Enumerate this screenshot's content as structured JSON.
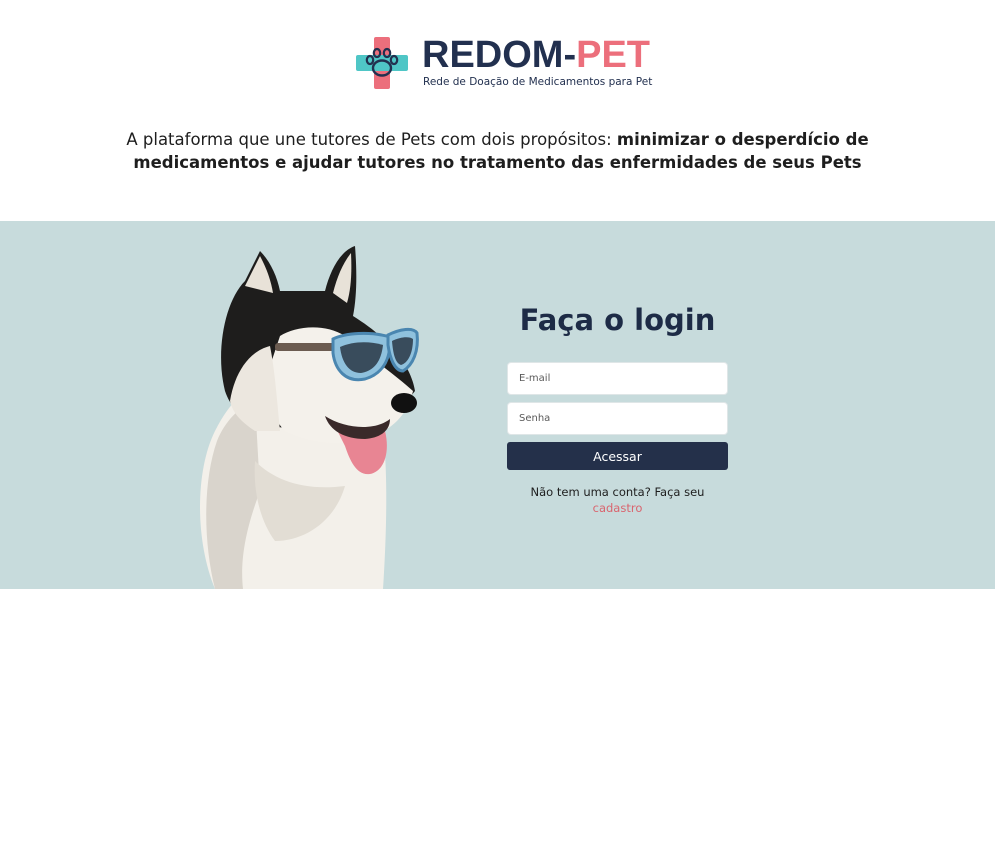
{
  "brand": {
    "name_part1": "REDOM-",
    "name_part2": "PET",
    "tagline": "Rede de Doação de Medicamentos para Pet",
    "colors": {
      "navy": "#22304f",
      "coral": "#ec6f7c",
      "teal": "#4fc6c6"
    }
  },
  "intro": {
    "text_regular": "A plataforma que une tutores de Pets com dois propósitos: ",
    "text_bold": "minimizar o desperdício de medicamentos e ajudar tutores no tratamento das enfermidades de seus Pets"
  },
  "hero": {
    "background": "#c7dbdc",
    "image_icon": "husky-with-sunglasses"
  },
  "login": {
    "title": "Faça o login",
    "email_placeholder": "E-mail",
    "password_placeholder": "Senha",
    "submit_label": "Acessar",
    "signup_prompt": "Não tem uma conta? Faça seu",
    "signup_link": "cadastro"
  }
}
